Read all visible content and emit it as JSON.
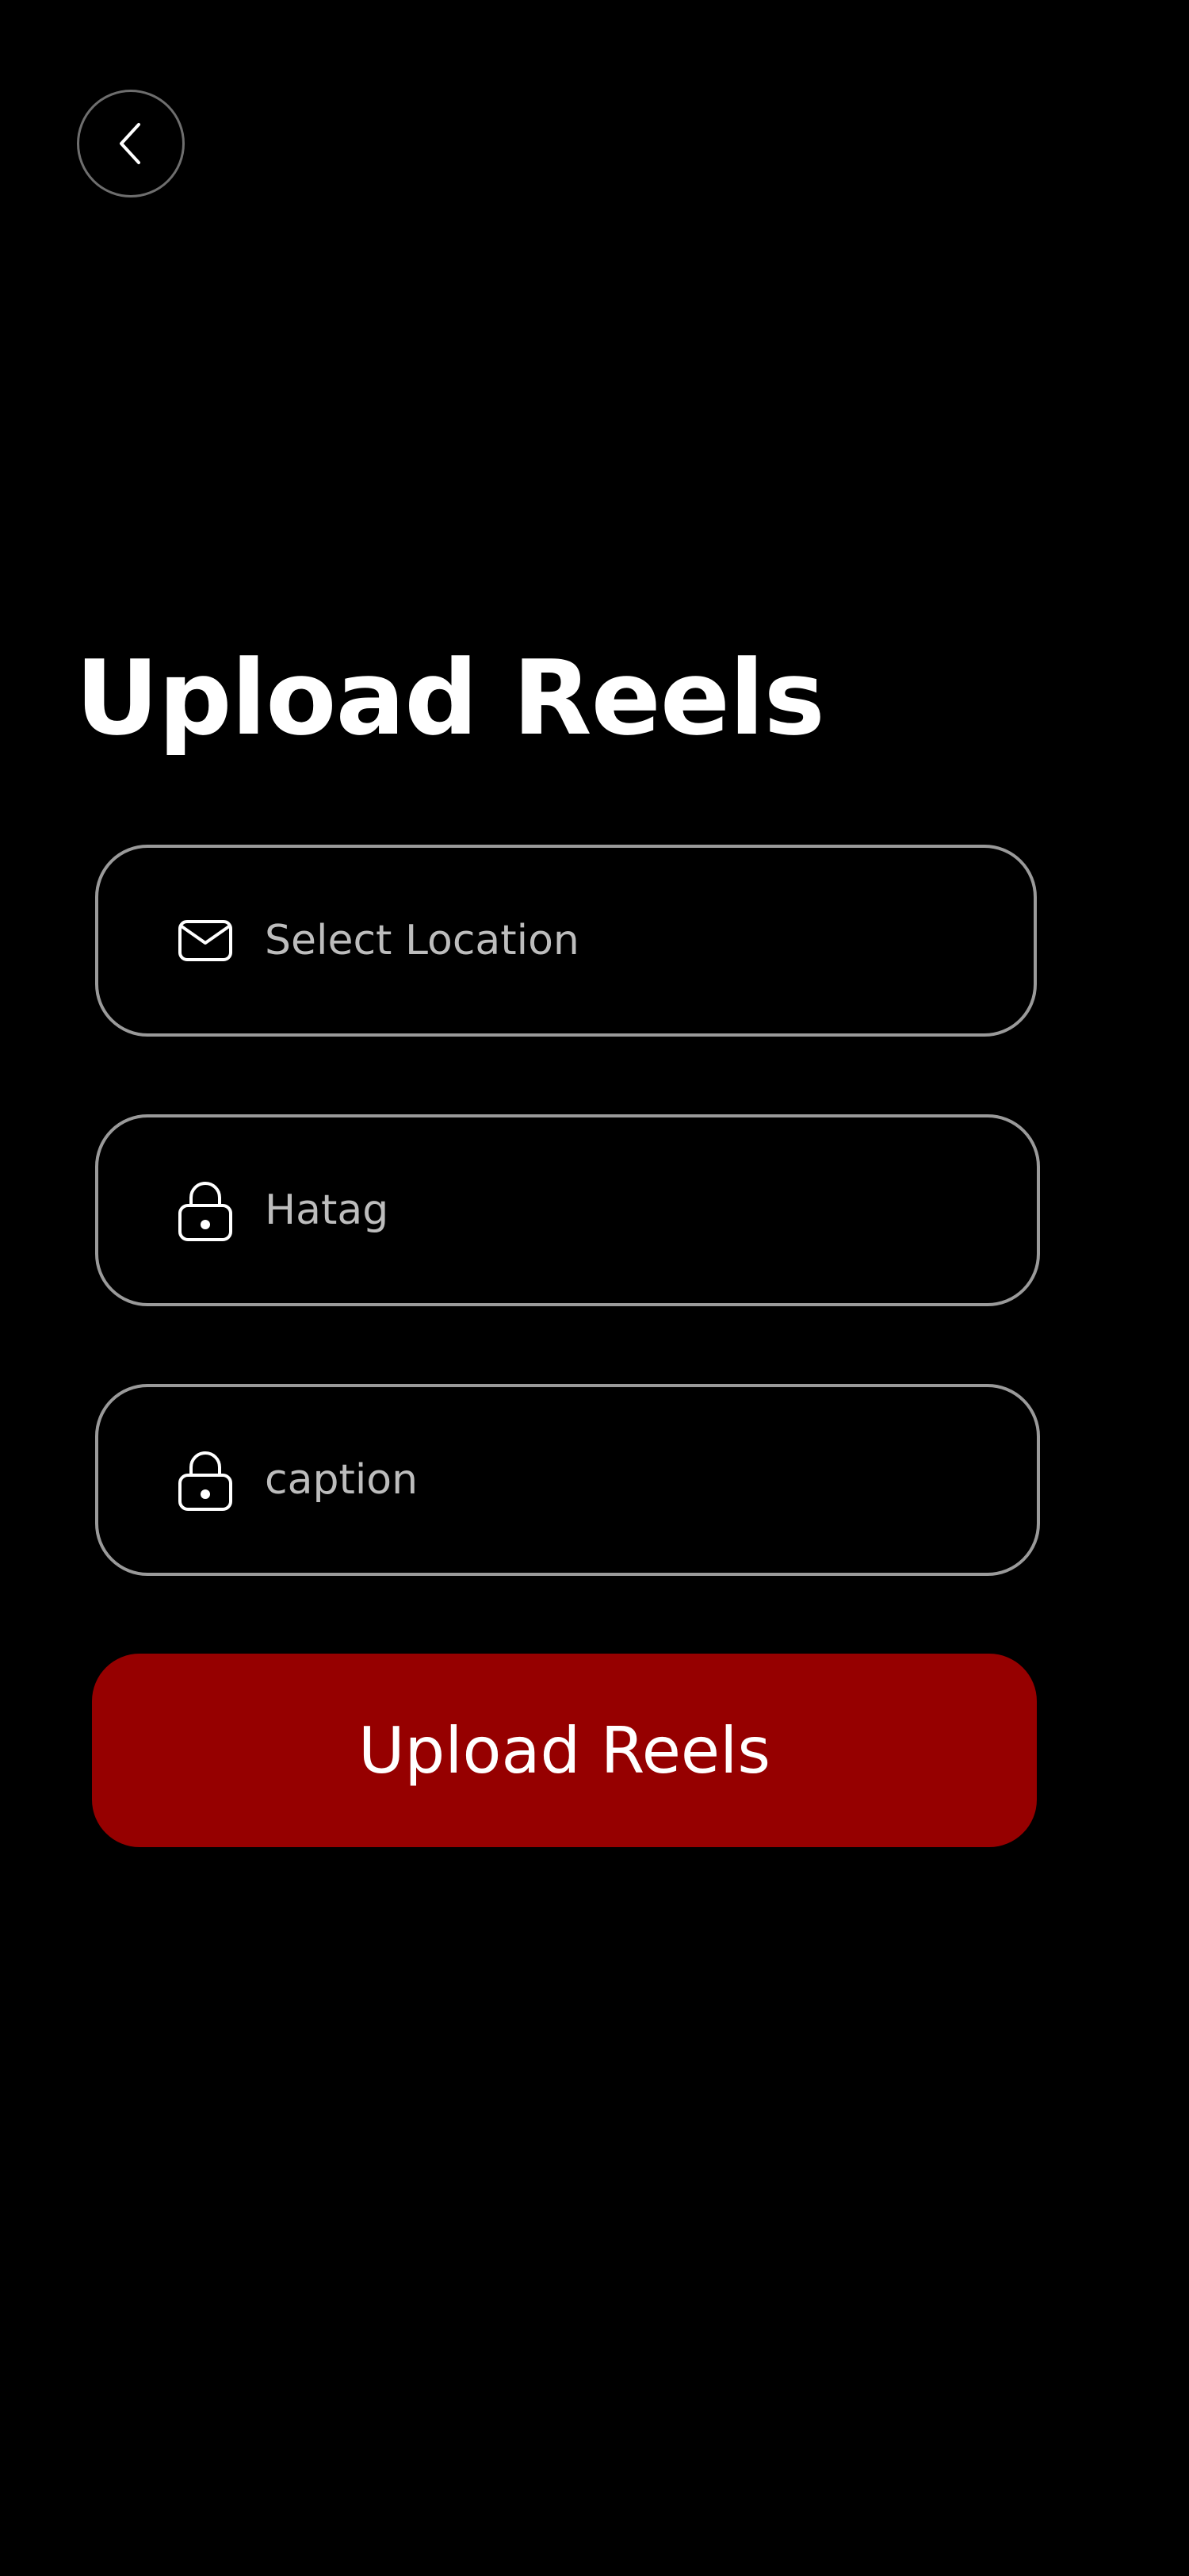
{
  "header": {
    "back_icon": "chevron-left-icon"
  },
  "page": {
    "title": "Upload Reels"
  },
  "form": {
    "fields": [
      {
        "icon": "envelope-icon",
        "placeholder": "Select Location",
        "value": ""
      },
      {
        "icon": "lock-icon",
        "placeholder": "Hatag",
        "value": ""
      },
      {
        "icon": "lock-icon",
        "placeholder": "caption",
        "value": ""
      }
    ],
    "submit_label": "Upload Reels"
  },
  "colors": {
    "background": "#000000",
    "accent": "#960000",
    "border": "#9a9a9a",
    "placeholder": "#bdbdbd",
    "text": "#ffffff"
  }
}
